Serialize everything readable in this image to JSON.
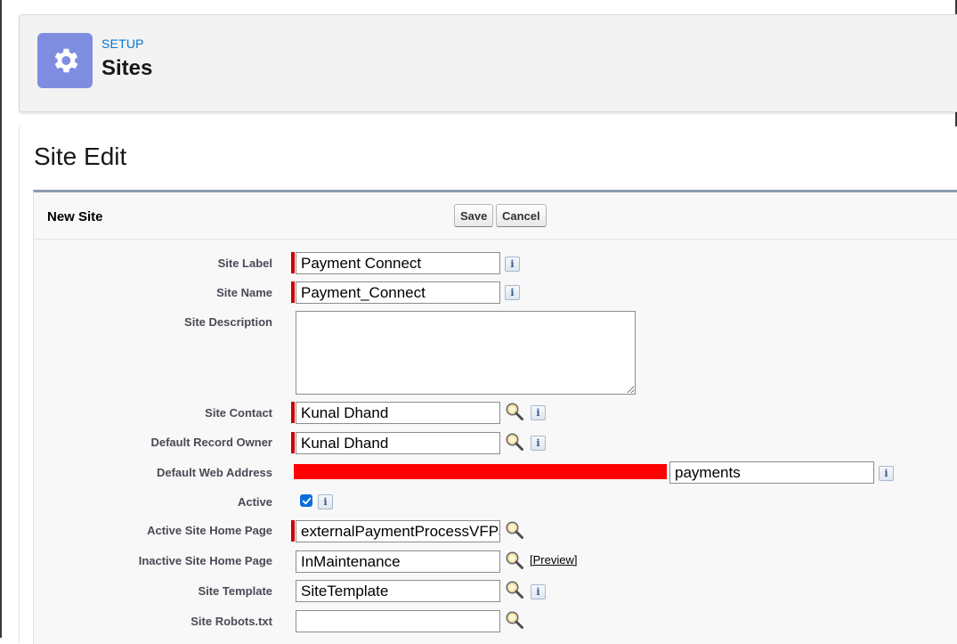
{
  "header": {
    "eyebrow": "SETUP",
    "title": "Sites",
    "icon": "gear-icon",
    "icon_color": "#7f8de1"
  },
  "page": {
    "title": "Site Edit"
  },
  "section": {
    "title": "New Site",
    "save_label": "Save",
    "cancel_label": "Cancel"
  },
  "fields": {
    "site_label": {
      "label": "Site Label",
      "value": "Payment Connect",
      "required": true
    },
    "site_name": {
      "label": "Site Name",
      "value": "Payment_Connect",
      "required": true
    },
    "site_description": {
      "label": "Site Description",
      "value": ""
    },
    "site_contact": {
      "label": "Site Contact",
      "value": "Kunal Dhand",
      "required": true
    },
    "default_record_owner": {
      "label": "Default Record Owner",
      "value": "Kunal Dhand",
      "required": true
    },
    "default_web_address": {
      "label": "Default Web Address",
      "value": "payments",
      "redacted_color": "#ff0000"
    },
    "active": {
      "label": "Active",
      "checked": true
    },
    "active_home_page": {
      "label": "Active Site Home Page",
      "value": "externalPaymentProcessVFPa",
      "required": true
    },
    "inactive_home_page": {
      "label": "Inactive Site Home Page",
      "value": "InMaintenance",
      "preview_link": "[Preview]"
    },
    "site_template": {
      "label": "Site Template",
      "value": "SiteTemplate"
    },
    "site_robots": {
      "label": "Site Robots.txt",
      "value": ""
    }
  },
  "colors": {
    "required_marker": "#cc0000",
    "link": "#0176d3"
  }
}
